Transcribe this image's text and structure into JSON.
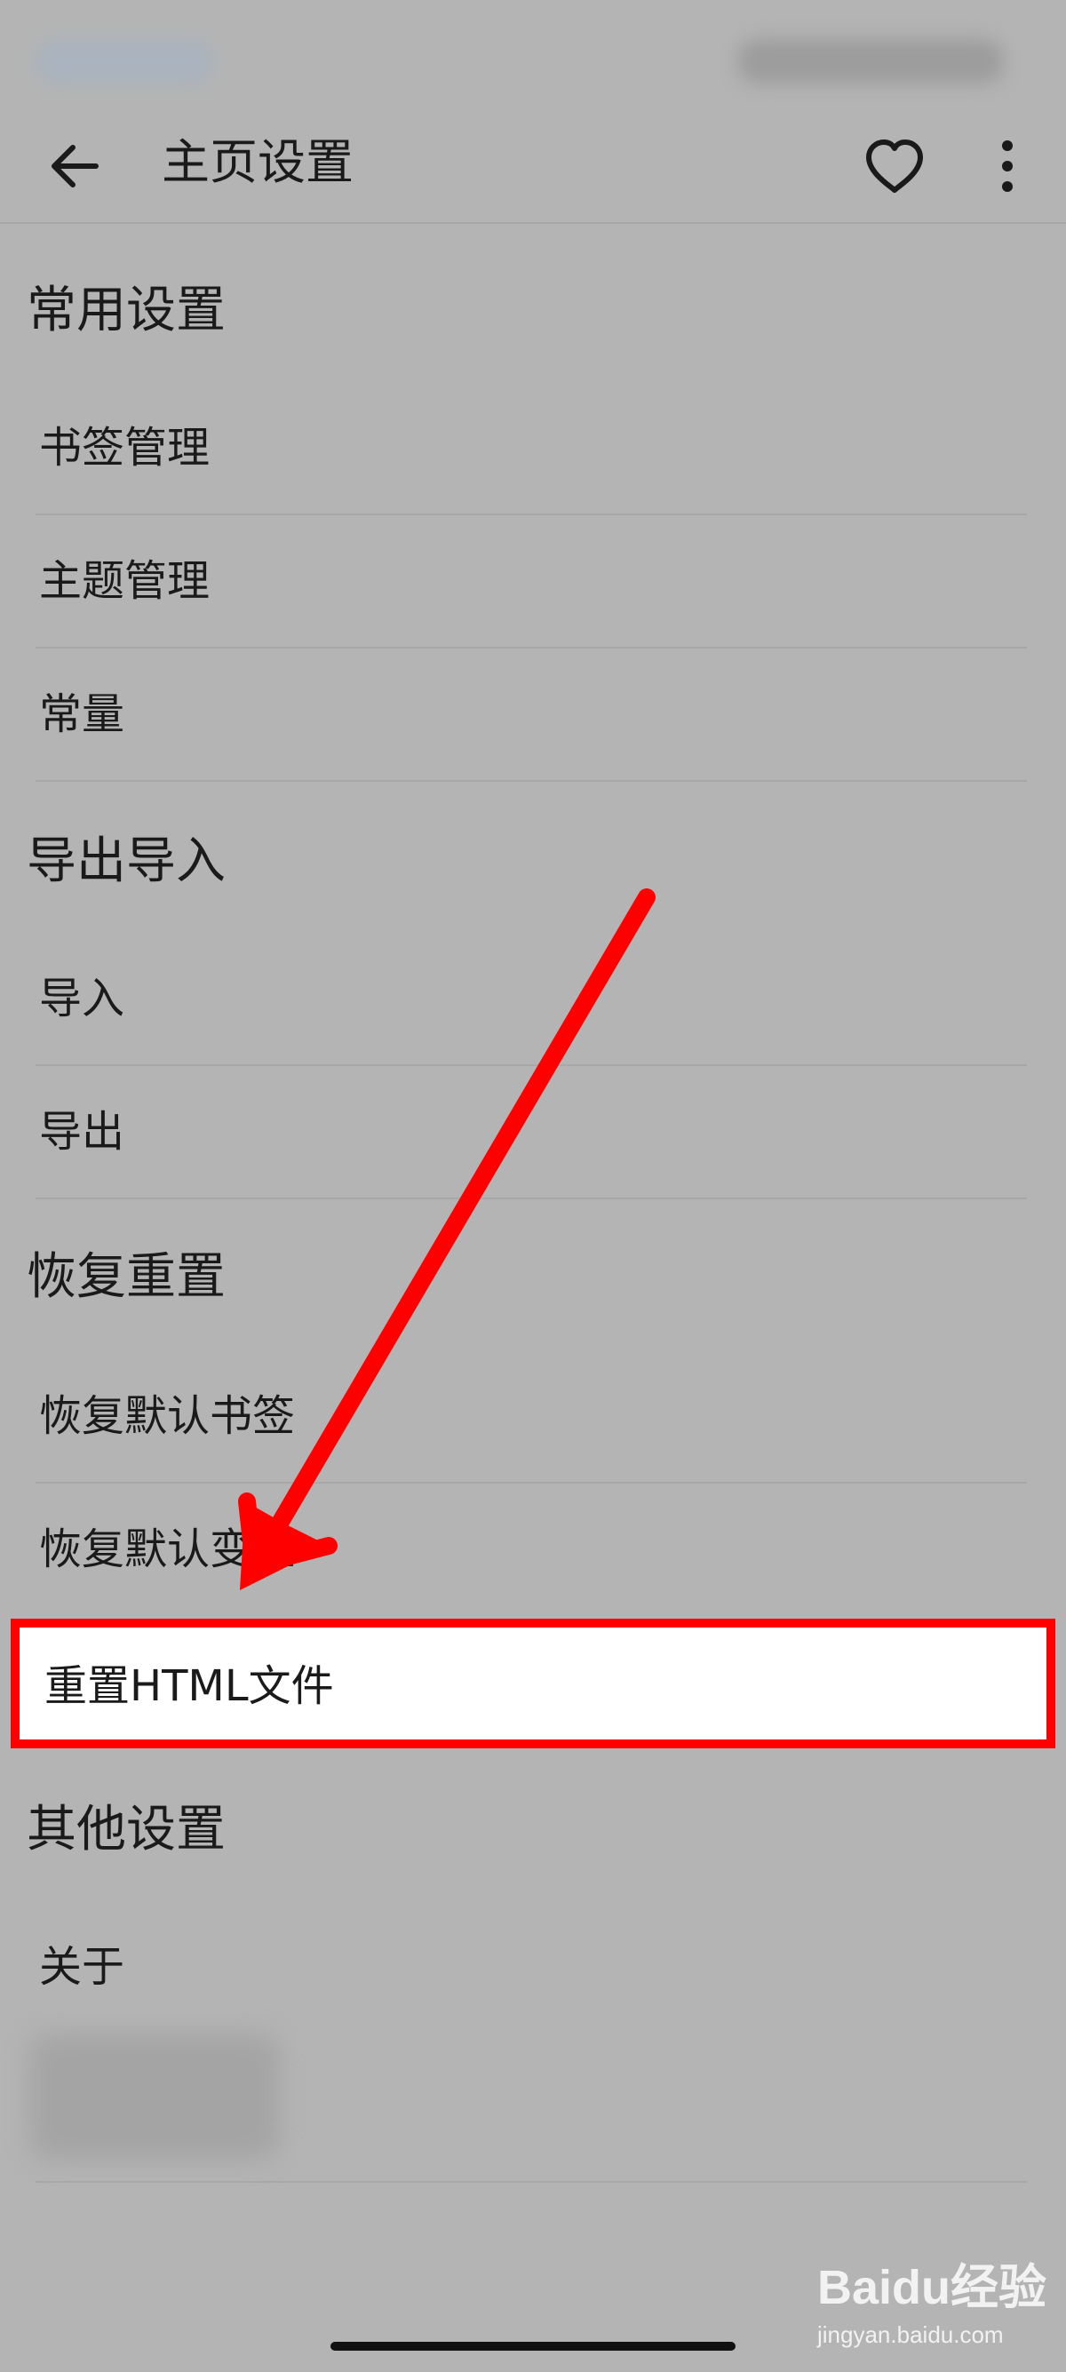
{
  "app_bar": {
    "title": "主页设置",
    "back_icon": "arrow-left-icon",
    "favorite_icon": "heart-outline-icon",
    "more_icon": "more-vertical-icon"
  },
  "sections": {
    "common": {
      "header": "常用设置",
      "items": [
        "书签管理",
        "主题管理",
        "常量"
      ]
    },
    "export_import": {
      "header": "导出导入",
      "items": [
        "导入",
        "导出"
      ]
    },
    "restore_reset": {
      "header": "恢复重置",
      "items": [
        "恢复默认书签",
        "恢复默认变量",
        "重置HTML文件"
      ]
    },
    "other": {
      "header": "其他设置",
      "items": [
        "关于"
      ]
    }
  },
  "annotation": {
    "highlight_color": "#ff0000",
    "highlighted_item": "重置HTML文件"
  },
  "watermark": {
    "logo": "Baidu经验",
    "url": "jingyan.baidu.com"
  }
}
